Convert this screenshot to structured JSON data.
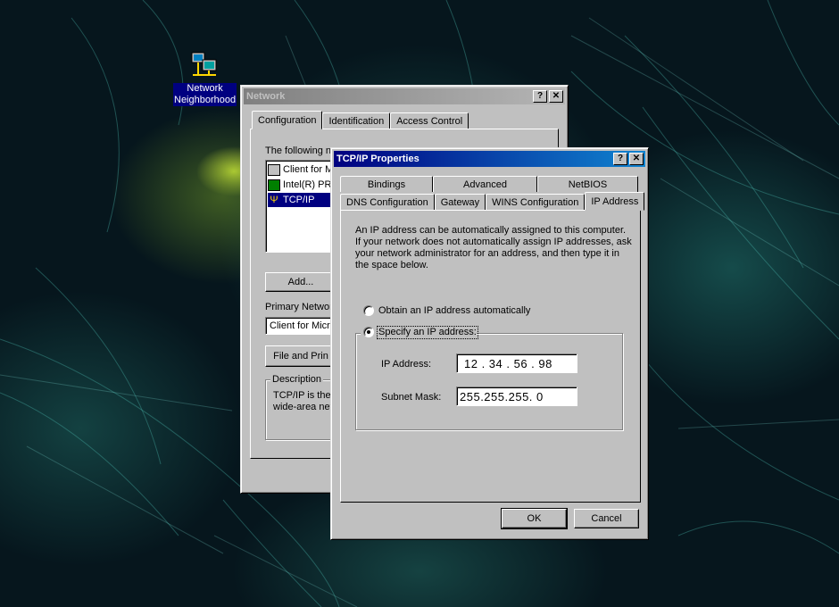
{
  "desktop": {
    "icon_label_line1": "Network",
    "icon_label_line2": "Neighborhood",
    "icon_name": "network-neighborhood-icon"
  },
  "network_window": {
    "title": "Network",
    "tabs": [
      "Configuration",
      "Identification",
      "Access Control"
    ],
    "intro_text": "The following n",
    "list_items": [
      {
        "label": "Client for M",
        "icon": "client-icon"
      },
      {
        "label": "Intel(R) PR",
        "icon": "network-card-icon"
      },
      {
        "label": "TCP/IP",
        "icon": "protocol-icon"
      }
    ],
    "add_button": "Add...",
    "primary_label": "Primary Networ",
    "primary_value": "Client for Micro",
    "file_print_button": "File and Prin",
    "description_title": "Description",
    "description_line1": "TCP/IP is the",
    "description_line2": "wide-area net"
  },
  "tcpip_window": {
    "title": "TCP/IP Properties",
    "tabs_back": [
      "Bindings",
      "Advanced",
      "NetBIOS"
    ],
    "tabs_front": [
      "DNS Configuration",
      "Gateway",
      "WINS Configuration",
      "IP Address"
    ],
    "selected_tab": "IP Address",
    "info_lines": [
      "An IP address can be automatically assigned to this computer.",
      "If your network does not automatically assign IP addresses, ask",
      "your network administrator for an address, and then type it in",
      "the space below."
    ],
    "radio_auto": "Obtain an IP address automatically",
    "radio_specify": "Specify an IP address:",
    "ip_label": "IP Address:",
    "ip_value": "12 . 34 . 56 . 98",
    "subnet_label": "Subnet Mask:",
    "subnet_value": "255.255.255. 0",
    "ok_button": "OK",
    "cancel_button": "Cancel"
  },
  "colors": {
    "title_active": "#000080",
    "title_inactive": "#808080",
    "face": "#c0c0c0"
  }
}
